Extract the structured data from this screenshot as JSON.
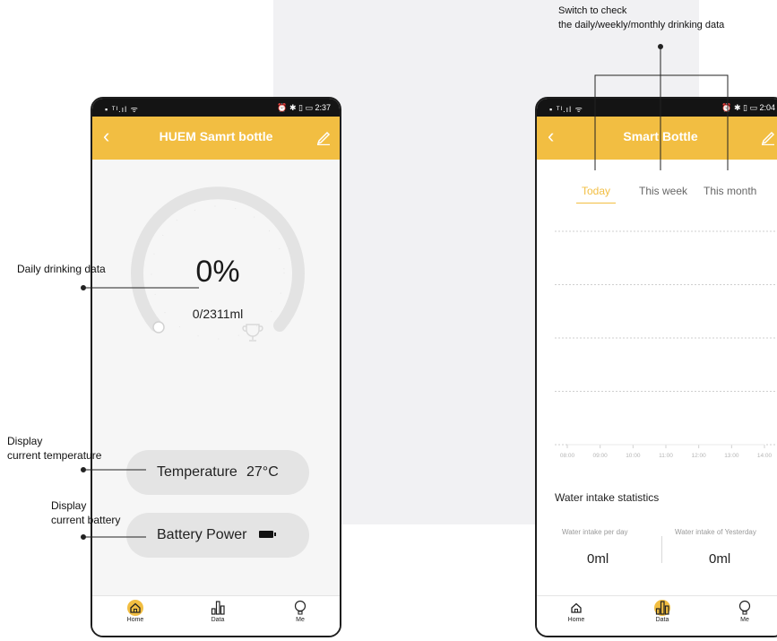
{
  "annotations": {
    "daily_drinking": "Daily drinking data",
    "temperature_line1": "Display",
    "temperature_line2": "current temperature",
    "battery_line1": "Display",
    "battery_line2": "current battery",
    "switch_line1": "Switch to check",
    "switch_line2": "the daily/weekly/monthly drinking data"
  },
  "phone1": {
    "status_left": "▪ ᵀᴵ.ıl ᯤ",
    "status_right": "⏰ ✱ ▯ ▭ 2:37",
    "title": "HUEM Samrt bottle",
    "gauge": {
      "percent": "0%",
      "amount": "0/2311ml",
      "progress": 0
    },
    "temperature": {
      "label": "Temperature",
      "value": "27°C"
    },
    "battery": {
      "label": "Battery Power"
    },
    "tabs": [
      "Home",
      "Data",
      "Me"
    ],
    "active_tab": "Home"
  },
  "phone2": {
    "status_left": "▪ ᵀᴵ.ıl ᯤ",
    "status_right": "⏰ ✱ ▯ ▭ 2:04",
    "title": "Smart Bottle",
    "range_tabs": [
      "Today",
      "This week",
      "This month"
    ],
    "active_range": "Today",
    "stats_title": "Water intake statistics",
    "per_day_label": "Water intake per day",
    "per_day_value": "0ml",
    "yesterday_label": "Water intake of Yesterday",
    "yesterday_value": "0ml",
    "tabs": [
      "Home",
      "Data",
      "Me"
    ],
    "active_tab": "Data"
  },
  "colors": {
    "accent": "#f2be42",
    "pill": "#e4e4e4",
    "gauge_track": "#e3e3e3"
  },
  "chart_data": {
    "type": "line",
    "x": [
      "08:00",
      "09:00",
      "10:00",
      "11:00",
      "12:00",
      "13:00",
      "14:00"
    ],
    "series": [
      {
        "values": [
          0,
          0,
          0,
          0,
          0,
          0,
          0
        ]
      }
    ],
    "yticks": [
      "0",
      "1",
      "2",
      "3",
      "4"
    ],
    "ylim": [
      0,
      4
    ],
    "grid": true
  }
}
